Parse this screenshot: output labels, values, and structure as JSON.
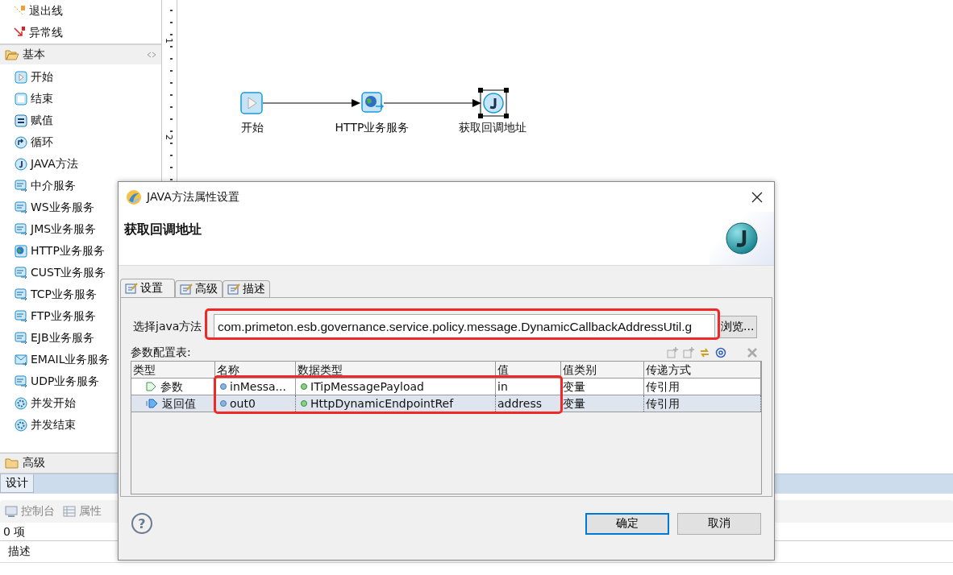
{
  "palette": {
    "connections": [
      {
        "label": "退出线",
        "kind": "exit"
      },
      {
        "label": "异常线",
        "kind": "exception"
      }
    ],
    "sections": [
      {
        "label": "基本",
        "expanded": true,
        "items": [
          {
            "label": "开始",
            "kind": "start"
          },
          {
            "label": "结束",
            "kind": "end"
          },
          {
            "label": "赋值",
            "kind": "assign"
          },
          {
            "label": "循环",
            "kind": "loop"
          },
          {
            "label": "JAVA方法",
            "kind": "java"
          },
          {
            "label": "中介服务",
            "kind": "service"
          },
          {
            "label": "WS业务服务",
            "kind": "service"
          },
          {
            "label": "JMS业务服务",
            "kind": "service"
          },
          {
            "label": "HTTP业务服务",
            "kind": "globe"
          },
          {
            "label": "CUST业务服务",
            "kind": "service"
          },
          {
            "label": "TCP业务服务",
            "kind": "service"
          },
          {
            "label": "FTP业务服务",
            "kind": "service"
          },
          {
            "label": "EJB业务服务",
            "kind": "service"
          },
          {
            "label": "EMAIL业务服务",
            "kind": "mail"
          },
          {
            "label": "UDP业务服务",
            "kind": "service"
          },
          {
            "label": "并发开始",
            "kind": "parallel"
          },
          {
            "label": "并发结束",
            "kind": "parallel"
          }
        ]
      },
      {
        "label": "高级",
        "expanded": false
      }
    ]
  },
  "ruler": {
    "labels": [
      "1",
      "2"
    ]
  },
  "diagram": {
    "nodes": [
      {
        "label": "开始",
        "kind": "start",
        "selected": false
      },
      {
        "label": "HTTP业务服务",
        "kind": "globe",
        "selected": false
      },
      {
        "label": "获取回调地址",
        "kind": "java",
        "selected": true
      }
    ]
  },
  "editor_tab": "设计",
  "bottom_panel": {
    "tabs": [
      {
        "label": "控制台",
        "kind": "console",
        "selected": false
      },
      {
        "label": "属性",
        "kind": "properties",
        "selected": false
      }
    ],
    "count": "0 项",
    "column": "描述"
  },
  "dialog": {
    "title": "JAVA方法属性设置",
    "heading": "获取回调地址",
    "tabs": [
      {
        "label": "设置",
        "selected": true
      },
      {
        "label": "高级",
        "selected": false
      },
      {
        "label": "描述",
        "selected": false
      }
    ],
    "method_label": "选择java方法",
    "method_value": "com.primeton.esb.governance.service.policy.message.DynamicCallbackAddressUtil.g",
    "browse_button": "浏览...",
    "table_label": "参数配置表:",
    "columns": [
      "类型",
      "名称",
      "数据类型",
      "值",
      "值类别",
      "传递方式"
    ],
    "rows": [
      {
        "type": "参数",
        "kind": "param",
        "name": "inMessa...",
        "data_type": "ITipMessagePayload",
        "value": "in",
        "value_kind": "变量",
        "pass_mode": "传引用",
        "selected": false
      },
      {
        "type": "返回值",
        "kind": "return",
        "name": "out0",
        "data_type": "HttpDynamicEndpointRef",
        "value": "address",
        "value_kind": "变量",
        "pass_mode": "传引用",
        "selected": true
      }
    ],
    "help": "?",
    "buttons": [
      {
        "label": "确定",
        "default": true
      },
      {
        "label": "取消",
        "default": false
      }
    ]
  }
}
